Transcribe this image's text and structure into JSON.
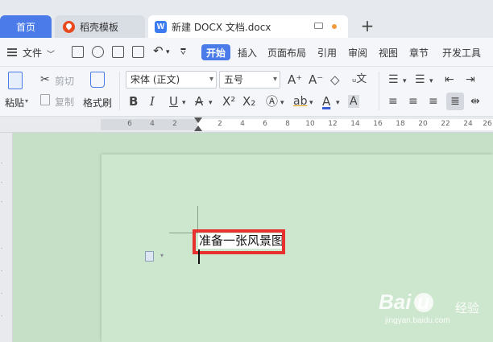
{
  "tabs": {
    "home": "首页",
    "daoke": "稻壳模板",
    "doc": "新建 DOCX 文档.docx",
    "add": "+"
  },
  "menu": {
    "file": "文件",
    "items": [
      "开始",
      "插入",
      "页面布局",
      "引用",
      "审阅",
      "视图",
      "章节",
      "开发工具"
    ]
  },
  "ribbon": {
    "paste": "粘贴",
    "cut": "剪切",
    "copy": "复制",
    "format_painter": "格式刷",
    "font_name": "宋体 (正文)",
    "font_size": "五号"
  },
  "ruler": {
    "ticks": [
      "6",
      "4",
      "2",
      "2",
      "4",
      "6",
      "8",
      "10",
      "12",
      "14",
      "16",
      "18",
      "20",
      "22",
      "24",
      "26"
    ]
  },
  "document": {
    "text": "准备一张风景图"
  },
  "watermark": {
    "brand": "Bai  u",
    "cn": "经验",
    "url": "jingyan.baidu.com"
  },
  "colors": {
    "accent": "#4a7be8",
    "highlight_border": "#e8312f",
    "page_background": "#cde6ce"
  }
}
